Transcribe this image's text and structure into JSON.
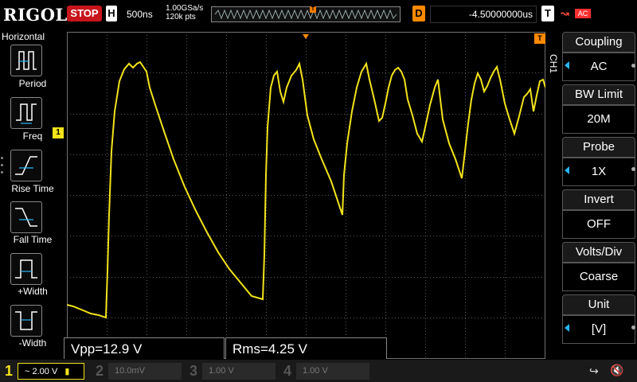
{
  "brand": "RIGOL",
  "top": {
    "run_state": "STOP",
    "h_label": "H",
    "timebase": "500ns",
    "sample_rate": "1.00GSa/s",
    "memory_depth": "120k pts",
    "delay_label": "D",
    "delay_value": "-4.50000000us",
    "trigger_label": "T",
    "trigger_slope_icon": "rising-edge-icon",
    "trigger_source": "AC"
  },
  "left_menu": {
    "title": "Horizontal",
    "items": [
      {
        "label": "Period",
        "icon": "period-icon"
      },
      {
        "label": "Freq",
        "icon": "frequency-icon"
      },
      {
        "label": "Rise Time",
        "icon": "rise-time-icon"
      },
      {
        "label": "Fall Time",
        "icon": "fall-time-icon"
      },
      {
        "label": "+Width",
        "icon": "positive-width-icon"
      },
      {
        "label": "-Width",
        "icon": "negative-width-icon"
      }
    ]
  },
  "right_menu": {
    "channel_tag": "CH1",
    "items": [
      {
        "label": "Coupling",
        "value": "AC",
        "has_arrow": true
      },
      {
        "label": "BW Limit",
        "value": "20M",
        "has_arrow": false
      },
      {
        "label": "Probe",
        "value": "1X",
        "has_arrow": true
      },
      {
        "label": "Invert",
        "value": "OFF",
        "has_arrow": false
      },
      {
        "label": "Volts/Div",
        "value": "Coarse",
        "has_arrow": false
      },
      {
        "label": "Unit",
        "value": "[V]",
        "has_arrow": true
      }
    ]
  },
  "markers": {
    "ch1_level": "1",
    "trigger_marker": "T"
  },
  "measurements": [
    {
      "text": "Vpp=12.9 V"
    },
    {
      "text": "Rms=4.25 V"
    }
  ],
  "channels": [
    {
      "num": "1",
      "value": "~ 2.00 V",
      "color": "#f2e31b",
      "active": true
    },
    {
      "num": "2",
      "value": "10.0mV",
      "color": "#29b6f6",
      "active": false
    },
    {
      "num": "3",
      "value": "1.00 V",
      "color": "#d63ad6",
      "active": false
    },
    {
      "num": "4",
      "value": "1.00 V",
      "color": "#2f6cff",
      "active": false
    }
  ],
  "colors": {
    "trace": "#f2e31b",
    "grid": "#707070",
    "stop": "#c8151c",
    "trigger": "#ff8a00",
    "accent": "#29b6f6"
  },
  "icons": [
    "usb-icon",
    "speaker-mute-icon"
  ]
}
